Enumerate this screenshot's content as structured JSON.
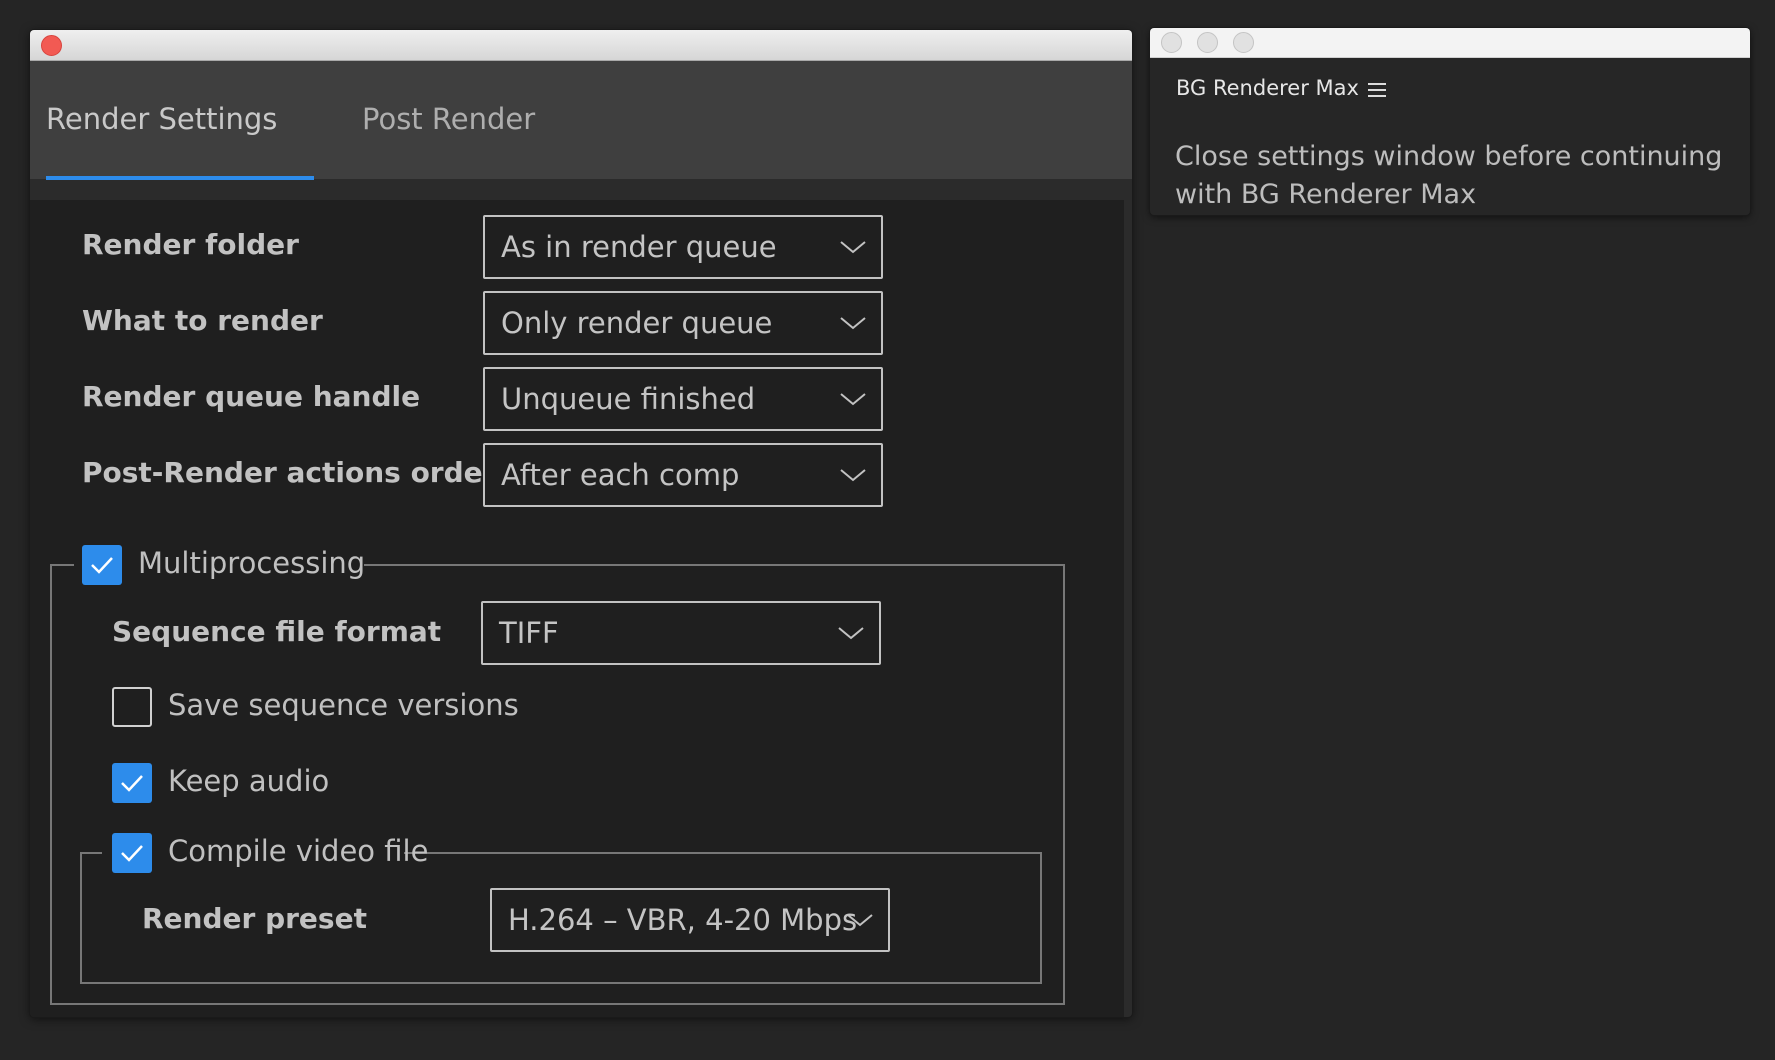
{
  "main_window": {
    "tabs": [
      {
        "label": "Render Settings",
        "active": true
      },
      {
        "label": "Post Render",
        "active": false
      }
    ],
    "settings": [
      {
        "label": "Render folder",
        "value": "As in render queue"
      },
      {
        "label": "What to render",
        "value": "Only render queue"
      },
      {
        "label": "Render queue handle",
        "value": "Unqueue finished"
      },
      {
        "label": "Post-Render actions order",
        "value": "After each comp"
      }
    ],
    "multiprocessing": {
      "label": "Multiprocessing",
      "checked": true,
      "sequence_format_label": "Sequence file format",
      "sequence_format_value": "TIFF",
      "save_versions": {
        "label": "Save sequence versions",
        "checked": false
      },
      "keep_audio": {
        "label": "Keep audio",
        "checked": true
      },
      "compile_video": {
        "label": "Compile video file",
        "checked": true,
        "render_preset_label": "Render preset",
        "render_preset_value": "H.264 – VBR, 4-20 Mbps"
      }
    }
  },
  "side_window": {
    "title": "BG Renderer Max",
    "menu_icon": "hamburger-icon",
    "message": "Close settings window before continuing with BG Renderer Max"
  },
  "colors": {
    "accent": "#2d8ceb",
    "close_button": "#f25a53",
    "background": "#252525",
    "panel": "#1f1f1f"
  }
}
